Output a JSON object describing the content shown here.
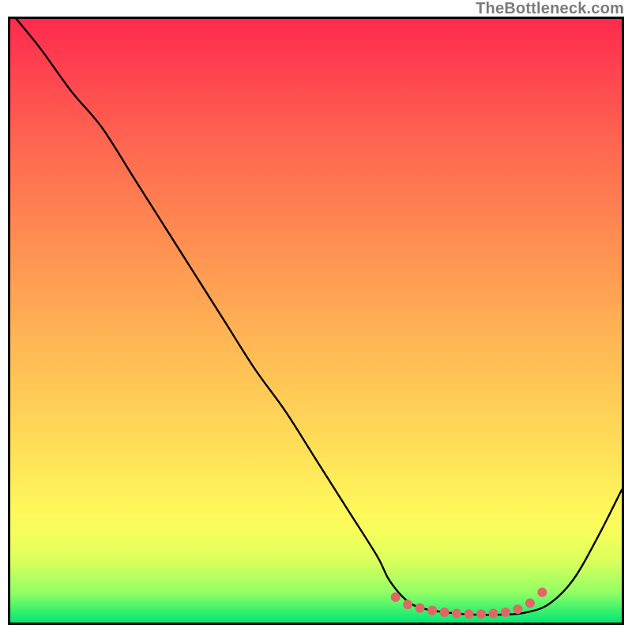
{
  "watermark": "TheBottleneck.com",
  "chart_data": {
    "type": "line",
    "title": "",
    "xlabel": "",
    "ylabel": "",
    "xlim": [
      0,
      100
    ],
    "ylim": [
      0,
      100
    ],
    "grid": false,
    "series": [
      {
        "name": "bottleneck-curve",
        "x": [
          1,
          5,
          10,
          15,
          20,
          25,
          30,
          35,
          40,
          45,
          50,
          55,
          60,
          62,
          65,
          68,
          72,
          76,
          80,
          84,
          88,
          92,
          96,
          100
        ],
        "y": [
          100,
          95,
          88,
          82,
          74,
          66,
          58,
          50,
          42,
          35,
          27,
          19,
          11,
          7,
          3.5,
          2.2,
          1.6,
          1.3,
          1.3,
          1.6,
          3.0,
          7,
          14,
          22
        ]
      },
      {
        "name": "highlight-dots",
        "x": [
          63,
          65,
          67,
          69,
          71,
          73,
          75,
          77,
          79,
          81,
          83,
          85,
          87
        ],
        "y": [
          4.2,
          3.0,
          2.4,
          2.0,
          1.7,
          1.5,
          1.4,
          1.4,
          1.5,
          1.7,
          2.2,
          3.2,
          5.0
        ]
      }
    ],
    "colors": {
      "curve": "#000000",
      "dots": "#e16666",
      "gradient_top": "#ff2a4e",
      "gradient_mid": "#ffe158",
      "gradient_bottom": "#00e874"
    }
  }
}
